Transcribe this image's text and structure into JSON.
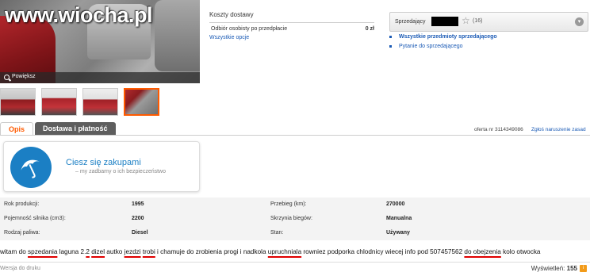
{
  "gallery": {
    "watermark": "www.wiocha.pl",
    "zoom_label": "Powiększ",
    "thumbnail_count": 4
  },
  "delivery": {
    "title": "Koszty dostawy",
    "option_label": "Odbiór osobisty po przedpłacie",
    "option_price": "0 zł",
    "all_options_link": "Wszystkie opcje"
  },
  "seller": {
    "label": "Sprzedający",
    "rating_count": "(16)",
    "all_items_link": "Wszystkie przedmioty sprzedającego",
    "ask_link": "Pytanie do sprzedającego"
  },
  "tabs": [
    {
      "label": "Opis"
    },
    {
      "label": "Dostawa i płatność"
    }
  ],
  "offer": {
    "number_text": "oferta nr 3114349086",
    "report_link": "Zgłoś naruszenie zasad"
  },
  "promo": {
    "title": "Ciesz się zakupami",
    "subtitle": "– my zadbamy o ich bezpieczeństwo"
  },
  "params": [
    {
      "k1": "Rok produkcji:",
      "v1": "1995",
      "k2": "Przebieg (km):",
      "v2": "270000"
    },
    {
      "k1": "Pojemność silnika (cm3):",
      "v1": "2200",
      "k2": "Skrzynia biegów:",
      "v2": "Manualna"
    },
    {
      "k1": "Rodzaj paliwa:",
      "v1": "Diesel",
      "k2": "Stan:",
      "v2": "Używany"
    }
  ],
  "description": {
    "p1": "witam do ",
    "e1": "spzedania",
    "p2": " laguna 2.",
    "e2": "2",
    "p3": " ",
    "e3": "dizel",
    "p4": " autko ",
    "e4": "jezdzi",
    "p5": " ",
    "e5": "trobi",
    "p6": " i chamuje do zrobienia progi i nadkola ",
    "e6": "upruchniala",
    "p7": " rowniez podporka chlodnicy wiecej info pod 507457562 ",
    "e7": "do obejzenia",
    "p8": " kolo otwocka"
  },
  "footer": {
    "print_label": "Wersja do druku",
    "views_label": "Wyświetleń:",
    "views_count": "155"
  },
  "colors": {
    "accent": "#ff5a00",
    "link": "#1a5ab5",
    "promo_blue": "#1b7fc4",
    "spelling_error": "#e00000"
  }
}
